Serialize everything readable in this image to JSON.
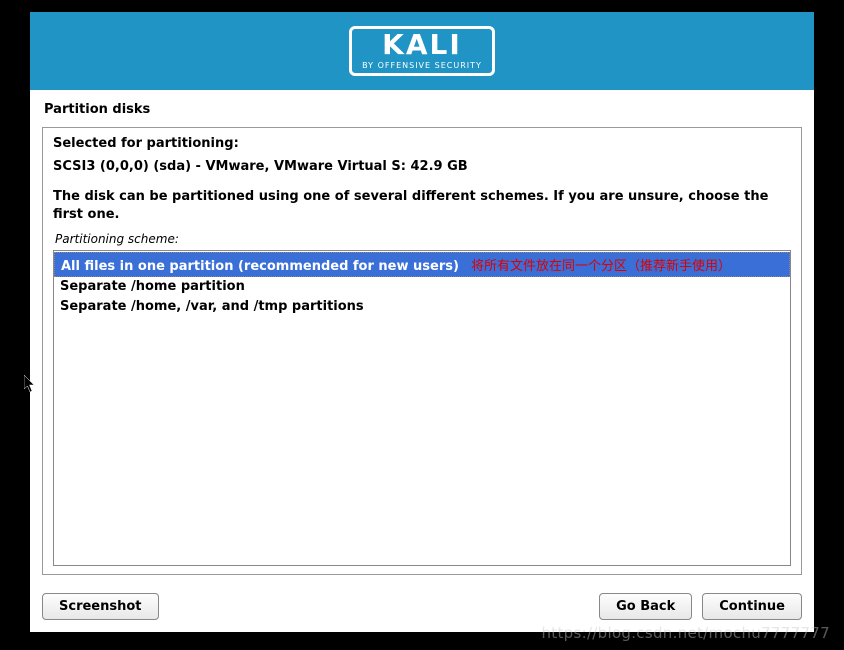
{
  "header": {
    "logo_text": "KALI",
    "logo_sub": "BY OFFENSIVE SECURITY"
  },
  "page_title": "Partition disks",
  "panel": {
    "selected_label": "Selected for partitioning:",
    "disk_info": "SCSI3 (0,0,0) (sda) - VMware, VMware Virtual S: 42.9 GB",
    "instruction": "The disk can be partitioned using one of several different schemes. If you are unsure, choose the first one.",
    "scheme_label": "Partitioning scheme:",
    "options": [
      {
        "label": "All files in one partition (recommended for new users)",
        "annotation": "将所有文件放在同一个分区（推荐新手使用）",
        "selected": true
      },
      {
        "label": "Separate /home partition",
        "annotation": "",
        "selected": false
      },
      {
        "label": "Separate /home, /var, and /tmp partitions",
        "annotation": "",
        "selected": false
      }
    ]
  },
  "buttons": {
    "screenshot": "Screenshot",
    "go_back": "Go Back",
    "continue": "Continue"
  },
  "watermark": "https://blog.csdn.net/mochu7777777"
}
